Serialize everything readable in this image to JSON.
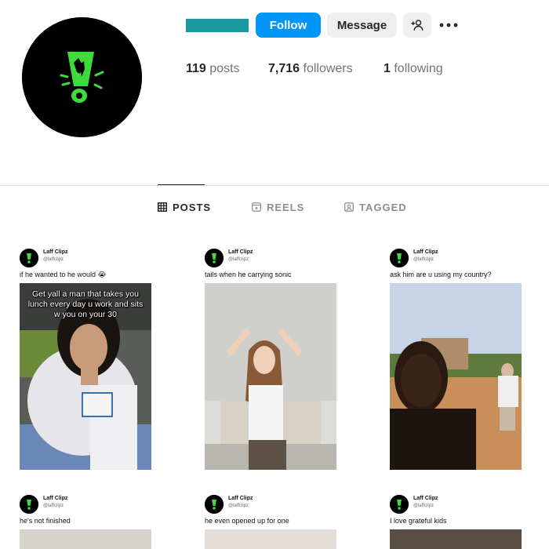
{
  "profile": {
    "name_bar_color": "#1a9aa0",
    "follow_label": "Follow",
    "message_label": "Message",
    "add_user_icon": "add-user-icon",
    "more_icon": "more-options-icon"
  },
  "stats": {
    "posts_count": "119",
    "posts_label": "posts",
    "followers_count": "7,716",
    "followers_label": "followers",
    "following_count": "1",
    "following_label": "following"
  },
  "tabs": [
    {
      "label": "POSTS",
      "icon": "grid-icon",
      "active": true
    },
    {
      "label": "REELS",
      "icon": "reels-icon",
      "active": false
    },
    {
      "label": "TAGGED",
      "icon": "tagged-icon",
      "active": false
    }
  ],
  "posts": [
    {
      "account": "Laff Clipz",
      "handle": "@laffclipz",
      "caption": "if he wanted to he would 😭",
      "overlay": "Get yall a man that takes you lunch every day u work and sits w you on your 30"
    },
    {
      "account": "Laff Clipz",
      "handle": "@laffclipz",
      "caption": "tails when he carrying sonic"
    },
    {
      "account": "Laff Clipz",
      "handle": "@laffclipz",
      "caption": "ask him are u using my country?"
    },
    {
      "account": "Laff Clipz",
      "handle": "@laffclipz",
      "caption": "he's not finished"
    },
    {
      "account": "Laff Clipz",
      "handle": "@laffclipz",
      "caption": "he even opened up for one"
    },
    {
      "account": "Laff Clipz",
      "handle": "@laffclipz",
      "caption": "I love grateful kids"
    }
  ],
  "colors": {
    "accent_blue": "#0095f6",
    "logo_green": "#3ddc3d"
  }
}
